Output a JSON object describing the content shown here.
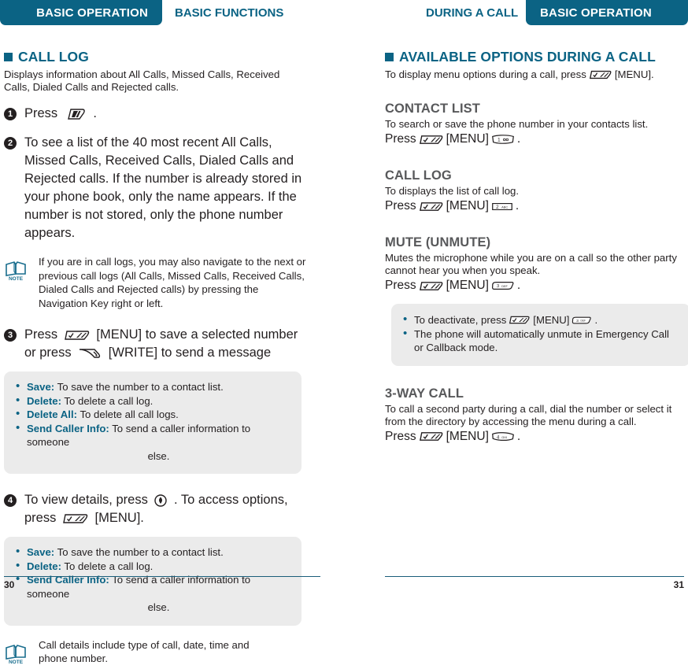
{
  "header": {
    "left_pill": "BASIC OPERATION",
    "left_plain": "BASIC FUNCTIONS",
    "right_plain": "DURING A CALL",
    "right_pill": "BASIC OPERATION",
    "accent_color": "#0b6384"
  },
  "left_page": {
    "section_title": "CALL LOG",
    "intro": "Displays information about All Calls, Missed Calls, Received Calls, Dialed Calls and Rejected calls.",
    "steps": [
      {
        "num": "1",
        "lead": "Press",
        "icon": "send-key-icon",
        "tail": "."
      },
      {
        "num": "2",
        "text": "To see a list of the 40 most recent All Calls, Missed Calls, Received Calls, Dialed Calls and Rejected calls. If the number is already stored in your phone book, only the name appears. If the number is not stored, only the phone number appears."
      },
      {
        "num": "3",
        "part1": "Press",
        "icon1": "menu-key-icon",
        "part2": "[MENU] to save a selected number or press",
        "icon2": "write-key-icon",
        "part3": "[WRITE] to send a message"
      },
      {
        "num": "4",
        "part1": "To view details, press",
        "icon1": "ok-key-icon",
        "part2": ". To access options, press",
        "icon2": "menu-key-icon",
        "part3": "[MENU]."
      }
    ],
    "note1": "If you are in call logs, you may also navigate to the next or previous call logs (All Calls, Missed Calls, Received Calls, Dialed Calls and Rejected calls) by pressing the Navigation Key right or left.",
    "options_box_1": [
      {
        "label": "Save:",
        "desc": "To save the number to a contact list.",
        "cont": ""
      },
      {
        "label": "Delete:",
        "desc": "To delete a call log.",
        "cont": ""
      },
      {
        "label": "Delete All:",
        "desc": "To delete all call logs.",
        "cont": ""
      },
      {
        "label": "Send Caller Info:",
        "desc": "To send a caller information to someone",
        "cont": "else."
      }
    ],
    "options_box_2": [
      {
        "label": "Save:",
        "desc": "To save the number to a contact list.",
        "cont": ""
      },
      {
        "label": "Delete:",
        "desc": "To delete a call log.",
        "cont": ""
      },
      {
        "label": "Send Caller Info:",
        "desc": "To send a caller information to someone",
        "cont": "else."
      }
    ],
    "note2": "Call details include type of call, date, time and phone number.",
    "note_icon_label": "NOTE",
    "page_number": "30"
  },
  "right_page": {
    "section_title": "AVAILABLE OPTIONS DURING A CALL",
    "intro_pre": "To display menu options during a call, press",
    "intro_post": "[MENU].",
    "subsections": [
      {
        "title": "CONTACT LIST",
        "desc": "To search or save the phone number in your contacts list.",
        "press_label": "Press",
        "menu_label": "[MENU]",
        "key_digit": "1",
        "key_letters": "◯◯",
        "period": "."
      },
      {
        "title": "CALL LOG",
        "desc": "To displays the list of call log.",
        "press_label": "Press",
        "menu_label": "[MENU]",
        "key_digit": "2",
        "key_letters": "ABC",
        "period": "."
      },
      {
        "title": "MUTE (UNMUTE)",
        "desc": "Mutes the microphone while you are on a call so the other party cannot hear you when you speak.",
        "press_label": "Press",
        "menu_label": "[MENU]",
        "key_digit": "3",
        "key_letters": "DEF",
        "period": "."
      },
      {
        "title": "3-WAY CALL",
        "desc": "To call a second party during a call, dial the number or select it from the directory by accessing the menu during a call.",
        "press_label": "Press",
        "menu_label": "[MENU]",
        "key_digit": "4",
        "key_letters": "GHI",
        "period": "."
      }
    ],
    "mute_box": [
      {
        "pre": "To deactivate, press",
        "menu": "[MENU]",
        "key_digit": "3",
        "key_letters": "DEF",
        "post": "."
      },
      {
        "pre": "The phone will automatically unmute in Emergency Call or Callback mode.",
        "menu": "",
        "key_digit": "",
        "key_letters": "",
        "post": ""
      }
    ],
    "page_number": "31"
  }
}
